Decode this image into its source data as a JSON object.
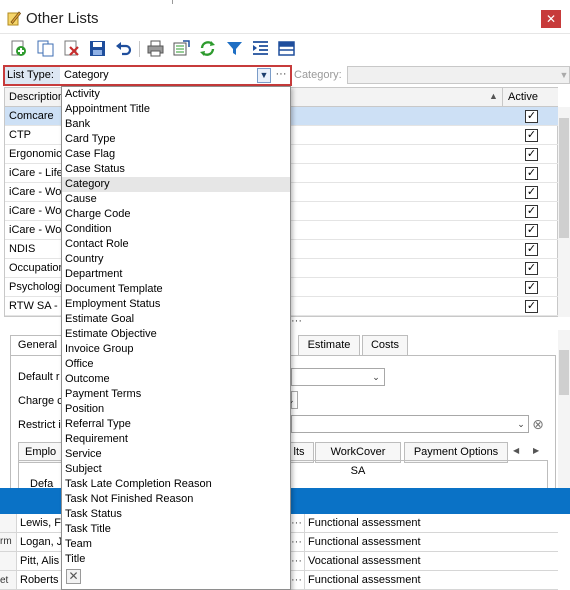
{
  "window": {
    "title": "Other Lists",
    "close_glyph": "✕"
  },
  "toolbar": {
    "buttons": [
      {
        "name": "add-icon",
        "color": "#2e9b2e"
      },
      {
        "name": "copy-icon",
        "color": "#3c6db3"
      },
      {
        "name": "delete-icon",
        "color": "#c62d2d"
      },
      {
        "name": "save-icon",
        "color": "#1f4e9c"
      },
      {
        "name": "undo-icon",
        "color": "#1f4e9c"
      },
      {
        "name": "print-icon",
        "color": "#555555"
      },
      {
        "name": "export-icon",
        "color": "#2e9b2e"
      },
      {
        "name": "refresh-icon",
        "color": "#2e9b2e"
      },
      {
        "name": "filter-icon",
        "color": "#1f6fc4"
      },
      {
        "name": "indent-icon",
        "color": "#1f4e9c"
      },
      {
        "name": "layout-icon",
        "color": "#1f4e9c"
      }
    ]
  },
  "list_type": {
    "label": "List Type:",
    "value": "Category",
    "more_glyph": "···",
    "dropdown_glyph": "▼"
  },
  "category": {
    "label": "Category:"
  },
  "grid": {
    "headers": {
      "description": "Description",
      "active": "Active"
    },
    "rows": [
      {
        "description": "Comcare",
        "active": true,
        "selected": true
      },
      {
        "description": "CTP",
        "active": true
      },
      {
        "description": "Ergonomics",
        "active": true
      },
      {
        "description": "iCare - Life",
        "active": true
      },
      {
        "description": "iCare - Wo",
        "active": true
      },
      {
        "description": "iCare - Wo",
        "active": true
      },
      {
        "description": "iCare - Wo",
        "active": true
      },
      {
        "description": "NDIS",
        "active": true
      },
      {
        "description": "Occupation",
        "active": true
      },
      {
        "description": "Psychologic",
        "active": true
      },
      {
        "description": "RTW SA - ",
        "active": true
      }
    ],
    "check_glyph": "✓",
    "more_glyph": "···"
  },
  "details": {
    "tabs": [
      {
        "label": "General",
        "active": true
      },
      {
        "label": "Estimate"
      },
      {
        "label": "Costs"
      }
    ],
    "fields": {
      "default_label": "Default r",
      "charge_label": "Charge c",
      "restrict_label": "Restrict i"
    },
    "clear_glyph": "⊗",
    "subtabs": [
      {
        "label": "Emplo"
      },
      {
        "label": "lts"
      },
      {
        "label": "WorkCover SA"
      },
      {
        "label": "Payment Options"
      }
    ],
    "subtab_nav": {
      "prev": "◀",
      "next": "▶"
    },
    "subfield_label": "Defa"
  },
  "results": {
    "rows": [
      {
        "name": "Lewis, F",
        "more": "···",
        "service": "Functional assessment"
      },
      {
        "name": "Logan, J",
        "more": "···",
        "service": "Functional assessment"
      },
      {
        "name": "Pitt, Alis",
        "more": "···",
        "service": "Vocational assessment"
      },
      {
        "name": "Roberts",
        "more": "···",
        "service": "Functional assessment"
      }
    ],
    "side_labels": [
      "rm",
      "et"
    ]
  },
  "dropdown": {
    "items": [
      "Activity",
      "Appointment Title",
      "Bank",
      "Card Type",
      "Case Flag",
      "Case Status",
      "Category",
      "Cause",
      "Charge Code",
      "Condition",
      "Contact Role",
      "Country",
      "Department",
      "Document Template",
      "Employment Status",
      "Estimate Goal",
      "Estimate Objective",
      "Invoice Group",
      "Office",
      "Outcome",
      "Payment Terms",
      "Position",
      "Referral Type",
      "Requirement",
      "Service",
      "Subject",
      "Task Late Completion Reason",
      "Task Not Finished Reason",
      "Task Status",
      "Task Title",
      "Team",
      "Title"
    ],
    "highlighted": "Category",
    "clear_glyph": "✕"
  }
}
